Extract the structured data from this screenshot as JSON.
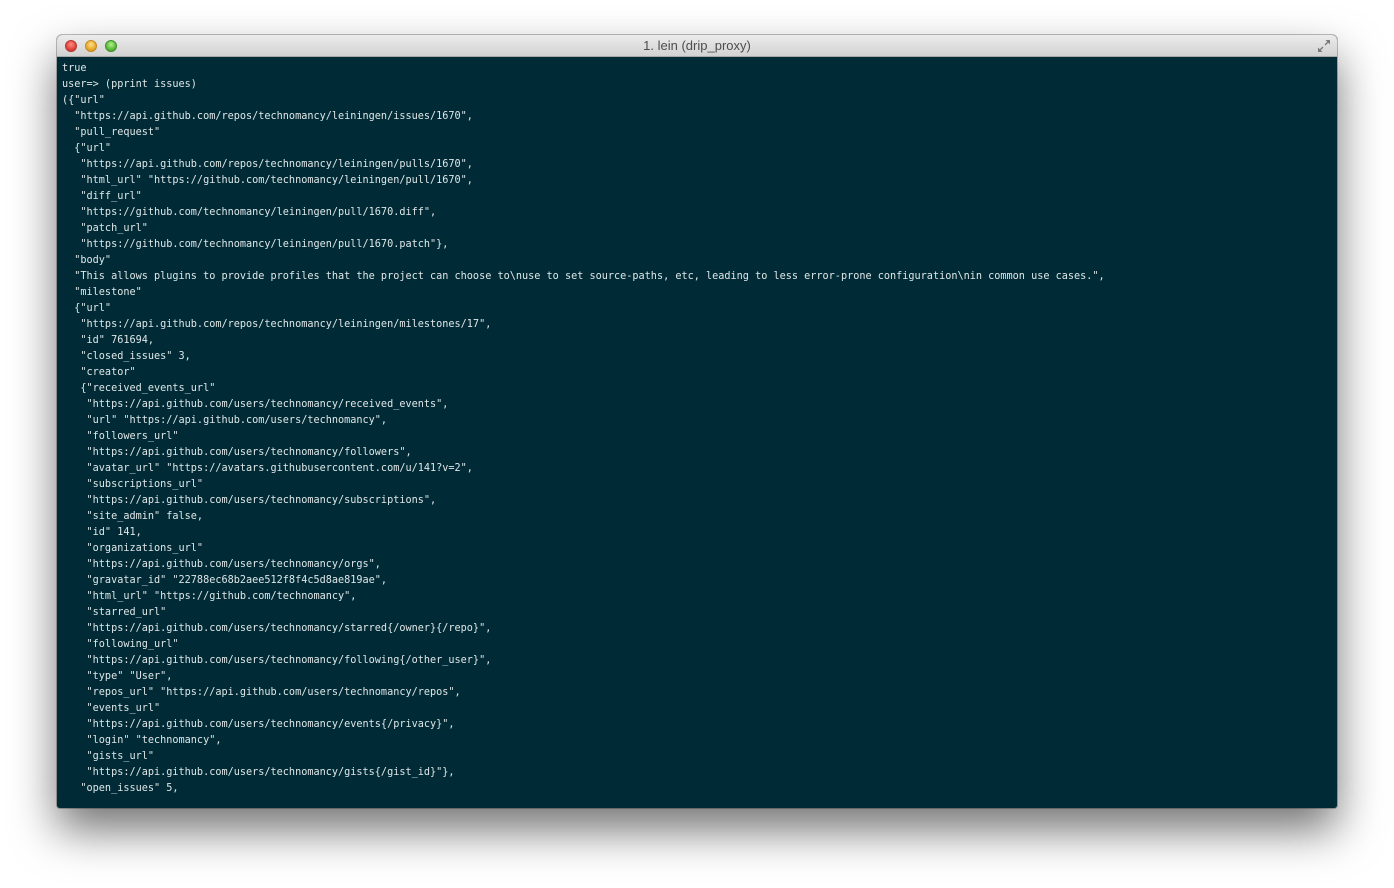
{
  "window": {
    "title": "1. lein (drip_proxy)"
  },
  "icons": {
    "close": "close-button-icon",
    "minimize": "minimize-button-icon",
    "zoom": "zoom-button-icon",
    "fullscreen": "fullscreen-arrows-icon"
  },
  "colors": {
    "terminal_background": "#002b36",
    "terminal_text": "#dfe7e8"
  },
  "terminal": {
    "lines": [
      "true",
      "user=> (pprint issues)",
      "({\"url\"",
      "  \"https://api.github.com/repos/technomancy/leiningen/issues/1670\",",
      "  \"pull_request\"",
      "  {\"url\"",
      "   \"https://api.github.com/repos/technomancy/leiningen/pulls/1670\",",
      "   \"html_url\" \"https://github.com/technomancy/leiningen/pull/1670\",",
      "   \"diff_url\"",
      "   \"https://github.com/technomancy/leiningen/pull/1670.diff\",",
      "   \"patch_url\"",
      "   \"https://github.com/technomancy/leiningen/pull/1670.patch\"},",
      "  \"body\"",
      "  \"This allows plugins to provide profiles that the project can choose to\\nuse to set source-paths, etc, leading to less error-prone configuration\\nin common use cases.\",",
      "  \"milestone\"",
      "  {\"url\"",
      "   \"https://api.github.com/repos/technomancy/leiningen/milestones/17\",",
      "   \"id\" 761694,",
      "   \"closed_issues\" 3,",
      "   \"creator\"",
      "   {\"received_events_url\"",
      "    \"https://api.github.com/users/technomancy/received_events\",",
      "    \"url\" \"https://api.github.com/users/technomancy\",",
      "    \"followers_url\"",
      "    \"https://api.github.com/users/technomancy/followers\",",
      "    \"avatar_url\" \"https://avatars.githubusercontent.com/u/141?v=2\",",
      "    \"subscriptions_url\"",
      "    \"https://api.github.com/users/technomancy/subscriptions\",",
      "    \"site_admin\" false,",
      "    \"id\" 141,",
      "    \"organizations_url\"",
      "    \"https://api.github.com/users/technomancy/orgs\",",
      "    \"gravatar_id\" \"22788ec68b2aee512f8f4c5d8ae819ae\",",
      "    \"html_url\" \"https://github.com/technomancy\",",
      "    \"starred_url\"",
      "    \"https://api.github.com/users/technomancy/starred{/owner}{/repo}\",",
      "    \"following_url\"",
      "    \"https://api.github.com/users/technomancy/following{/other_user}\",",
      "    \"type\" \"User\",",
      "    \"repos_url\" \"https://api.github.com/users/technomancy/repos\",",
      "    \"events_url\"",
      "    \"https://api.github.com/users/technomancy/events{/privacy}\",",
      "    \"login\" \"technomancy\",",
      "    \"gists_url\"",
      "    \"https://api.github.com/users/technomancy/gists{/gist_id}\"},",
      "   \"open_issues\" 5,"
    ]
  }
}
